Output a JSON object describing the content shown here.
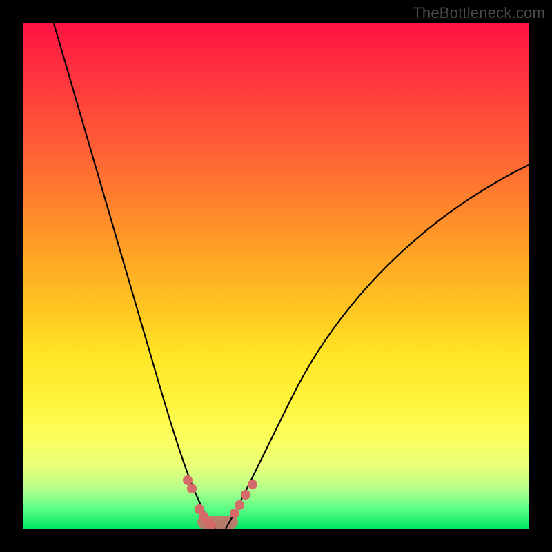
{
  "watermark": "TheBottleneck.com",
  "chart_data": {
    "type": "line",
    "title": "",
    "xlabel": "",
    "ylabel": "",
    "xlim": [
      0,
      100
    ],
    "ylim": [
      0,
      100
    ],
    "series": [
      {
        "name": "left-curve",
        "x": [
          6,
          10,
          14,
          18,
          22,
          26,
          30,
          33,
          35,
          37
        ],
        "y": [
          100,
          80,
          62,
          46,
          32,
          20,
          11,
          5,
          2,
          0
        ]
      },
      {
        "name": "right-curve",
        "x": [
          40,
          42,
          45,
          50,
          56,
          64,
          74,
          86,
          100
        ],
        "y": [
          0,
          2,
          6,
          14,
          24,
          36,
          49,
          61,
          72
        ]
      },
      {
        "name": "markers-left",
        "x": [
          32.5,
          33.3,
          34.8,
          35.6,
          36.4,
          37.2
        ],
        "y": [
          9.5,
          8.0,
          3.8,
          2.4,
          1.3,
          0.6
        ]
      },
      {
        "name": "markers-right",
        "x": [
          41.8,
          42.8,
          44.0,
          45.3
        ],
        "y": [
          3.0,
          4.6,
          6.6,
          8.8
        ]
      },
      {
        "name": "valley-band",
        "x": [
          34.5,
          42.5
        ],
        "y": [
          0,
          0
        ]
      }
    ],
    "colors": {
      "curve": "#000000",
      "marker": "#d46a6a",
      "band": "#d46a6a"
    }
  }
}
